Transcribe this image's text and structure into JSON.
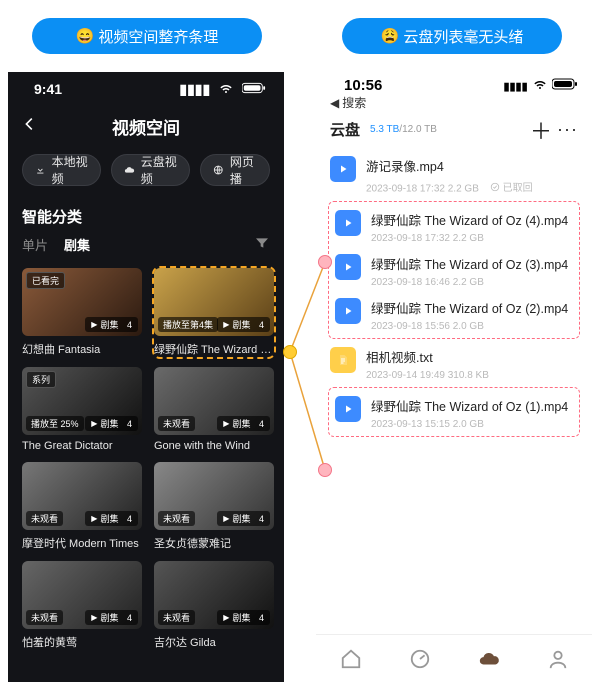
{
  "pills": {
    "left_emoji": "😄",
    "left_text": "视频空间整齐条理",
    "right_emoji": "😩",
    "right_text": "云盘列表毫无头绪"
  },
  "left_phone": {
    "status_time": "9:41",
    "header_title": "视频空间",
    "chips": {
      "local": "本地视频",
      "cloud": "云盘视频",
      "web": "网页播"
    },
    "section_title": "智能分类",
    "tabs": {
      "single": "单片",
      "series": "剧集"
    },
    "cards": [
      {
        "tl": "已看完",
        "bl": "",
        "br_label": "剧集",
        "br_count": "4",
        "title": "幻想曲 Fantasia"
      },
      {
        "tl": "",
        "bl": "播放至第4集",
        "br_label": "剧集",
        "br_count": "4",
        "title": "绿野仙踪 The Wizard of Oz"
      },
      {
        "tl": "系列",
        "bl": "播放至 25%",
        "br_label": "剧集",
        "br_count": "4",
        "title": "The Great Dictator"
      },
      {
        "tl": "",
        "bl": "未观看",
        "br_label": "剧集",
        "br_count": "4",
        "title": "Gone with the Wind"
      },
      {
        "tl": "",
        "bl": "未观看",
        "br_label": "剧集",
        "br_count": "4",
        "title": "摩登时代 Modern Times"
      },
      {
        "tl": "",
        "bl": "未观看",
        "br_label": "剧集",
        "br_count": "4",
        "title": "圣女贞德蒙难记"
      },
      {
        "tl": "",
        "bl": "未观看",
        "br_label": "剧集",
        "br_count": "4",
        "title": "怕羞的黄莺"
      },
      {
        "tl": "",
        "bl": "未观看",
        "br_label": "剧集",
        "br_count": "4",
        "title": "吉尔达 Gilda"
      }
    ]
  },
  "right_phone": {
    "status_time": "10:56",
    "search_label": "搜索",
    "tab_label": "云盘",
    "storage_used": "5.3 TB",
    "storage_total": "/12.0 TB",
    "items": [
      {
        "icon": "video",
        "name": "游记录像.mp4",
        "meta": "2023-09-18 17:32   2.2 GB",
        "extra_icon": true,
        "extra": "已取回"
      },
      {
        "icon": "video",
        "name": "绿野仙踪 The Wizard of Oz (4).mp4",
        "meta": "2023-09-18 17:32   2.2 GB"
      },
      {
        "icon": "video",
        "name": "绿野仙踪 The Wizard of Oz (3).mp4",
        "meta": "2023-09-18 16:46   2.2 GB"
      },
      {
        "icon": "video",
        "name": "绿野仙踪 The Wizard of Oz (2).mp4",
        "meta": "2023-09-18 15:56   2.0 GB"
      },
      {
        "icon": "txt",
        "name": "相机视频.txt",
        "meta": "2023-09-14 19:49   310.8 KB"
      },
      {
        "icon": "video",
        "name": "绿野仙踪 The Wizard of Oz (1).mp4",
        "meta": "2023-09-13 15:15   2.0 GB"
      }
    ]
  }
}
